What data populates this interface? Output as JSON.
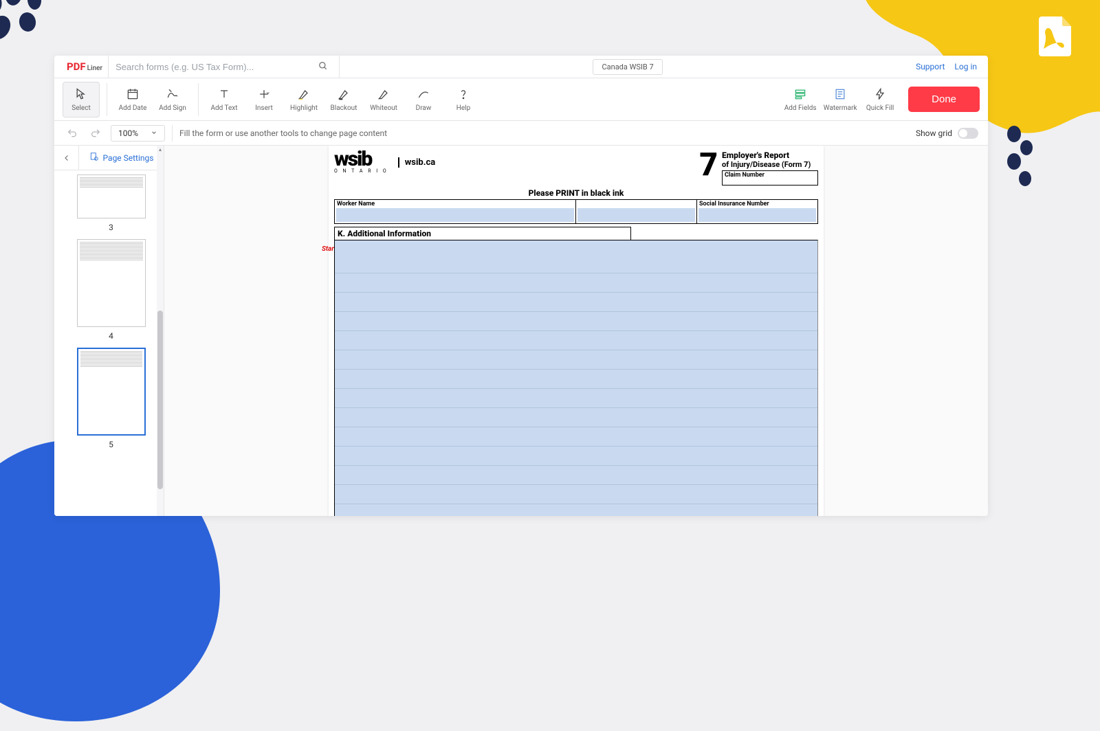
{
  "brand": {
    "pdf": "PDF",
    "liner": "Liner"
  },
  "search": {
    "placeholder": "Search forms (e.g. US Tax Form)..."
  },
  "doc_title": "Canada WSIB 7",
  "header_links": {
    "support": "Support",
    "login": "Log in"
  },
  "toolbar": {
    "select": "Select",
    "add_date": "Add Date",
    "add_sign": "Add Sign",
    "add_text": "Add Text",
    "insert": "Insert",
    "highlight": "Highlight",
    "blackout": "Blackout",
    "whiteout": "Whiteout",
    "draw": "Draw",
    "help": "Help",
    "add_fields": "Add Fields",
    "watermark": "Watermark",
    "quick_fill": "Quick Fill",
    "done": "Done"
  },
  "subbar": {
    "zoom": "100%",
    "hint": "Fill the form or use another tools to change page content",
    "show_grid": "Show grid"
  },
  "sidebar": {
    "page_settings": "Page Settings",
    "thumbs": [
      {
        "num": "3"
      },
      {
        "num": "4"
      },
      {
        "num": "5"
      }
    ]
  },
  "form": {
    "wsib": "wsib",
    "ontario": "O N T A R I O",
    "url": "wsib.ca",
    "seven": "7",
    "title1": "Employer's Report",
    "title2": "of Injury/Disease (Form 7)",
    "claim": "Claim Number",
    "print_hint": "Please PRINT in black ink",
    "worker_name": "Worker Name",
    "sin": "Social Insurance Number",
    "section_k": "K. Additional Information",
    "start": "Start"
  }
}
